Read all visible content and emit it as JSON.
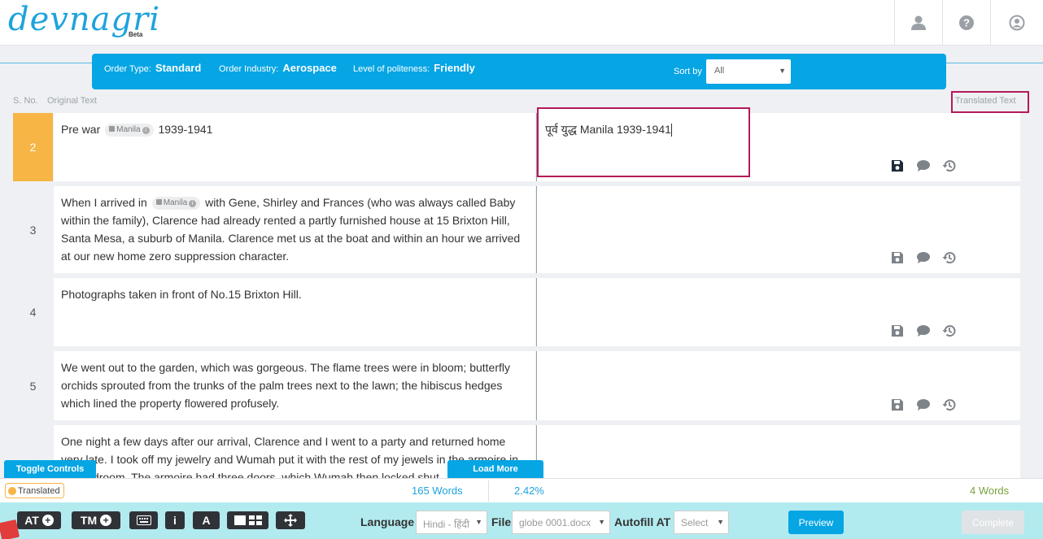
{
  "header": {
    "logo": "devnagri",
    "beta": "Beta"
  },
  "order": {
    "type_label": "Order Type:",
    "type_value": "Standard",
    "industry_label": "Order Industry:",
    "industry_value": "Aerospace",
    "politeness_label": "Level of politeness:",
    "politeness_value": "Friendly",
    "sort_label": "Sort by",
    "sort_value": "All"
  },
  "columns": {
    "sno": "S. No.",
    "original": "Original Text",
    "translated": "Translated Text"
  },
  "tag": {
    "label": "Manila"
  },
  "rows": [
    {
      "sno": "2",
      "pre": "Pre war",
      "post": "1939-1941",
      "translation": "पूर्व युद्ध Manila 1939-1941"
    },
    {
      "sno": "3",
      "pre": "When I arrived in",
      "post": "with Gene, Shirley and Frances (who was always called Baby within the family), Clarence had already rented a partly furnished house at 15 Brixton Hill, Santa Mesa, a suburb of Manila. Clarence met us at the boat and within an hour we arrived at our new home zero suppression character."
    },
    {
      "sno": "4",
      "text": "Photographs taken in front of No.15 Brixton Hill."
    },
    {
      "sno": "5",
      "text": "We went out to the garden, which was gorgeous. The flame trees were in bloom; butterfly orchids sprouted from the trunks of the palm trees next to the lawn; the hibiscus hedges which lined the property flowered profusely."
    },
    {
      "sno": "",
      "text": "One night a few days after our arrival, Clarence and I went to a party and returned home very late. I took off my jewelry and Wumah put it with the rest of my jewels in the armoire in the bedroom. The armoire had three doors, which Wumah then locked shut."
    }
  ],
  "controls": {
    "toggle": "Toggle Controls",
    "load_more": "Load More"
  },
  "status": {
    "badge": "Translated",
    "words_total": "165 Words",
    "percent": "2.42%",
    "words_done": "4 Words"
  },
  "toolbar": {
    "at": "AT",
    "tm": "TM",
    "info": "i",
    "font": "A",
    "language_label": "Language",
    "language_value": "Hindi - हिंदी",
    "file_label": "File",
    "file_value": "globe 0001.docx",
    "autofill_label": "Autofill AT",
    "autofill_value": "Select",
    "preview": "Preview",
    "complete": "Complete"
  },
  "colors": {
    "accent": "#06a5e4",
    "highlight": "#b5195a",
    "active_row": "#f7b545",
    "toolbar_bg": "#b2ebef"
  }
}
